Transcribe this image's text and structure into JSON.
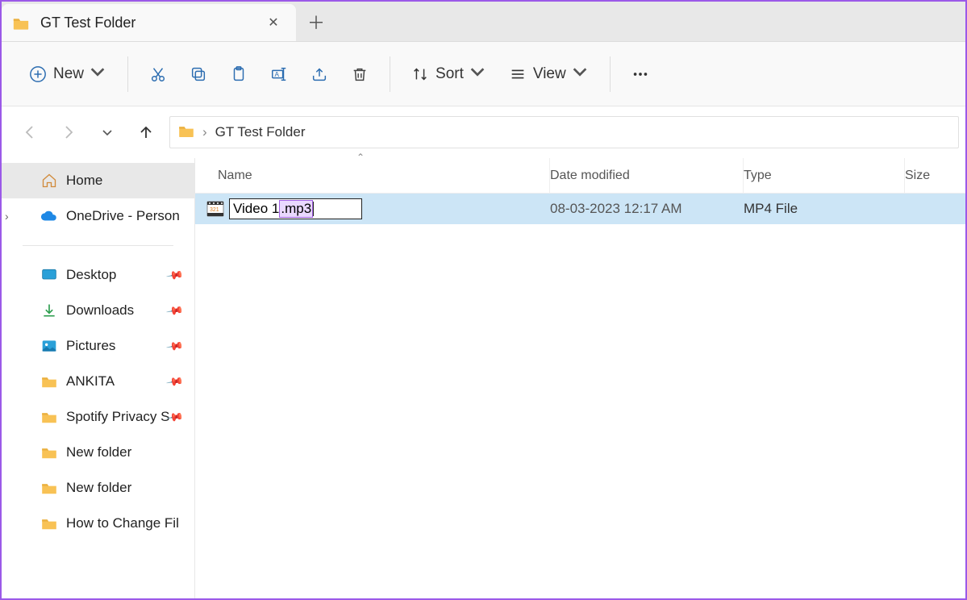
{
  "tab": {
    "title": "GT Test Folder"
  },
  "toolbar": {
    "new": "New",
    "sort": "Sort",
    "view": "View"
  },
  "breadcrumb": {
    "path": "GT Test Folder"
  },
  "sidebar": {
    "home": "Home",
    "onedrive": "OneDrive - Person",
    "quick": [
      {
        "label": "Desktop",
        "pinned": true,
        "icon": "desktop"
      },
      {
        "label": "Downloads",
        "pinned": true,
        "icon": "downloads"
      },
      {
        "label": "Pictures",
        "pinned": true,
        "icon": "pictures"
      },
      {
        "label": "ANKITA",
        "pinned": true,
        "icon": "folder"
      },
      {
        "label": "Spotify Privacy S",
        "pinned": true,
        "icon": "folder"
      },
      {
        "label": "New folder",
        "pinned": false,
        "icon": "folder"
      },
      {
        "label": "New folder",
        "pinned": false,
        "icon": "folder"
      },
      {
        "label": "How to Change Fil",
        "pinned": false,
        "icon": "folder"
      }
    ]
  },
  "columns": {
    "name": "Name",
    "date": "Date modified",
    "type": "Type",
    "size": "Size"
  },
  "file": {
    "rename_base": "Video 1",
    "rename_ext": ".mp3",
    "date": "08-03-2023 12:17 AM",
    "type": "MP4 File"
  }
}
